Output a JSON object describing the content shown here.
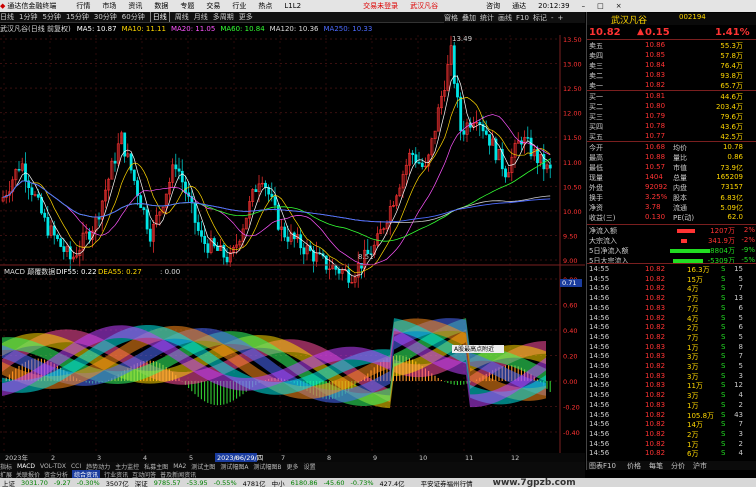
{
  "app_title": "通达信金融终端",
  "menus": [
    "行情",
    "市场",
    "资讯",
    "数据",
    "专题",
    "交易",
    "行业",
    "热点",
    "L1L2"
  ],
  "top_links": [
    "交易未登录",
    "武汉凡谷"
  ],
  "window_controls": {
    "msg": "咨询",
    "notify": "通达",
    "time": "20:12:39"
  },
  "periods": [
    "日线",
    "1分钟",
    "5分钟",
    "15分钟",
    "30分钟",
    "60分钟",
    "日线",
    "周线",
    "月线",
    "多周期",
    "更多"
  ],
  "right_tools": [
    "窗格",
    "叠加",
    "统计",
    "画线",
    "F10",
    "标记",
    "-",
    "+"
  ],
  "ma_bar": {
    "stock": "武汉凡谷(日线 前复权)",
    "ma5": "MA5: 10.87",
    "ma10": "MA10: 11.11",
    "ma20": "MA20: 11.05",
    "ma60": "MA60: 10.84",
    "ma120": "MA120: 10.36",
    "ma250": "MA250: 10.33"
  },
  "price_axis": [
    "13.50",
    "13.00",
    "12.50",
    "12.00",
    "11.50",
    "11.00",
    "10.50",
    "10.00",
    "9.50",
    "9.00"
  ],
  "price_annotations": {
    "high": "13.49",
    "low": "8.51"
  },
  "macd_bar": {
    "name": "MACD 颠覆数据",
    "dif": "DIF55: 0.22",
    "dea": "DEA55: 0.27",
    "macd": ": 0.00",
    "val": "0.71"
  },
  "macd_axis": [
    "0.80",
    "0.60",
    "0.40",
    "0.20",
    "0.00",
    "-0.20",
    "-0.40"
  ],
  "tooltip": "A股最高点附近",
  "date_label": "2023/06/29/四",
  "date_axis": [
    "2023年",
    "2",
    "3",
    "4",
    "5",
    "6",
    "7",
    "8",
    "9",
    "10",
    "11",
    "12"
  ],
  "indicator_tabs": [
    "指标",
    "MACD",
    "VOL-TDX",
    "CCI",
    "趋势动力",
    "主力监控",
    "私募主图",
    "MA2",
    "测试主图",
    "测试幅图A",
    "测试幅图B",
    "更多",
    "设置"
  ],
  "bottom_tabs": [
    "扩展",
    "关联报价",
    "资金分析",
    "综合资讯",
    "行业资讯",
    "互动问答",
    "普及新闻资讯"
  ],
  "quote": {
    "name": "武汉凡谷",
    "code": "002194",
    "price": "10.82",
    "change": "0.15",
    "pct": "1.41%",
    "asks": [
      {
        "label": "卖五",
        "price": "10.86",
        "vol": "55.3万"
      },
      {
        "label": "卖四",
        "price": "10.85",
        "vol": "57.8万"
      },
      {
        "label": "卖三",
        "price": "10.84",
        "vol": "76.4万"
      },
      {
        "label": "卖二",
        "price": "10.83",
        "vol": "93.8万"
      },
      {
        "label": "卖一",
        "price": "10.82",
        "vol": "65.7万"
      }
    ],
    "bids": [
      {
        "label": "买一",
        "price": "10.81",
        "vol": "44.6万"
      },
      {
        "label": "买二",
        "price": "10.80",
        "vol": "203.4万"
      },
      {
        "label": "买三",
        "price": "10.79",
        "vol": "79.6万"
      },
      {
        "label": "买四",
        "price": "10.78",
        "vol": "43.6万"
      },
      {
        "label": "买五",
        "price": "10.77",
        "vol": "42.5万"
      }
    ],
    "stats": [
      {
        "l1": "今开",
        "v1": "10.68",
        "l2": "均价",
        "v2": "10.78"
      },
      {
        "l1": "最高",
        "v1": "10.88",
        "l2": "量比",
        "v2": "0.86"
      },
      {
        "l1": "最低",
        "v1": "10.57",
        "l2": "市值",
        "v2": "73.9亿"
      },
      {
        "l1": "现量",
        "v1": "1404",
        "l2": "总量",
        "v2": "165209"
      },
      {
        "l1": "外盘",
        "v1": "92092",
        "l2": "内盘",
        "v2": "73157"
      },
      {
        "l1": "换手",
        "v1": "3.25%",
        "l2": "股本",
        "v2": "6.83亿"
      },
      {
        "l1": "净资",
        "v1": "3.78",
        "l2": "流通",
        "v2": "5.09亿"
      },
      {
        "l1": "收益(三)",
        "v1": "0.130",
        "l2": "PE(动)",
        "v2": "62.0"
      }
    ],
    "flows": [
      {
        "label": "净流入额",
        "val": "1207万",
        "pct": "2%",
        "color": "#ff3333",
        "w": 18
      },
      {
        "label": "大宗流入",
        "val": "341.9万",
        "pct": "-2%",
        "color": "#ff3333",
        "w": 6
      },
      {
        "label": "5日净流入额",
        "val": "-8804万",
        "pct": "-9%",
        "color": "#22dd22",
        "w": 40
      },
      {
        "label": "5日大宗流入",
        "val": "-5309万",
        "pct": "-5%",
        "color": "#22dd22",
        "w": 30
      }
    ],
    "ticks": [
      {
        "t": "14:55",
        "p": "10.82",
        "v": "16.3万",
        "s": "S",
        "n": "15"
      },
      {
        "t": "14:55",
        "p": "10.82",
        "v": "15万",
        "s": "S",
        "n": "5"
      },
      {
        "t": "14:56",
        "p": "10.82",
        "v": "4万",
        "s": "S",
        "n": "7"
      },
      {
        "t": "14:56",
        "p": "10.82",
        "v": "7万",
        "s": "S",
        "n": "13"
      },
      {
        "t": "14:56",
        "p": "10.83",
        "v": "7万",
        "s": "S",
        "n": "6"
      },
      {
        "t": "14:56",
        "p": "10.82",
        "v": "4万",
        "s": "S",
        "n": "5"
      },
      {
        "t": "14:56",
        "p": "10.82",
        "v": "2万",
        "s": "S",
        "n": "6"
      },
      {
        "t": "14:56",
        "p": "10.82",
        "v": "7万",
        "s": "S",
        "n": "5"
      },
      {
        "t": "14:56",
        "p": "10.83",
        "v": "1万",
        "s": "S",
        "n": "8"
      },
      {
        "t": "14:56",
        "p": "10.83",
        "v": "3万",
        "s": "S",
        "n": "7"
      },
      {
        "t": "14:56",
        "p": "10.82",
        "v": "3万",
        "s": "S",
        "n": "5"
      },
      {
        "t": "14:56",
        "p": "10.83",
        "v": "3万",
        "s": "S",
        "n": "3"
      },
      {
        "t": "14:56",
        "p": "10.83",
        "v": "11万",
        "s": "S",
        "n": "12"
      },
      {
        "t": "14:56",
        "p": "10.82",
        "v": "3万",
        "s": "S",
        "n": "4"
      },
      {
        "t": "14:56",
        "p": "10.83",
        "v": "1万",
        "s": "S",
        "n": "2"
      },
      {
        "t": "14:56",
        "p": "10.82",
        "v": "105.8万",
        "s": "S",
        "n": "43"
      },
      {
        "t": "14:56",
        "p": "10.82",
        "v": "14万",
        "s": "S",
        "n": "7"
      },
      {
        "t": "14:56",
        "p": "10.82",
        "v": "2万",
        "s": "S",
        "n": "3"
      },
      {
        "t": "14:56",
        "p": "10.82",
        "v": "1万",
        "s": "S",
        "n": "2"
      },
      {
        "t": "14:56",
        "p": "10.82",
        "v": "6万",
        "s": "S",
        "n": "4"
      }
    ],
    "panel_tabs": [
      "图表F10",
      "价格",
      "每笔",
      "分价",
      "沪市"
    ]
  },
  "status": [
    {
      "name": "上证",
      "val": "3031.70",
      "chg": "-9.27",
      "pct": "-0.30%",
      "amt": "3507亿"
    },
    {
      "name": "深证",
      "val": "9785.57",
      "chg": "-53.95",
      "pct": "-0.55%",
      "amt": "4781亿"
    },
    {
      "name": "中小",
      "val": "6180.86",
      "chg": "-45.60",
      "pct": "-0.73%",
      "amt": "427.4亿"
    }
  ],
  "broker": "平安证券福州行情",
  "watermark": "www.7gpzb.com"
}
